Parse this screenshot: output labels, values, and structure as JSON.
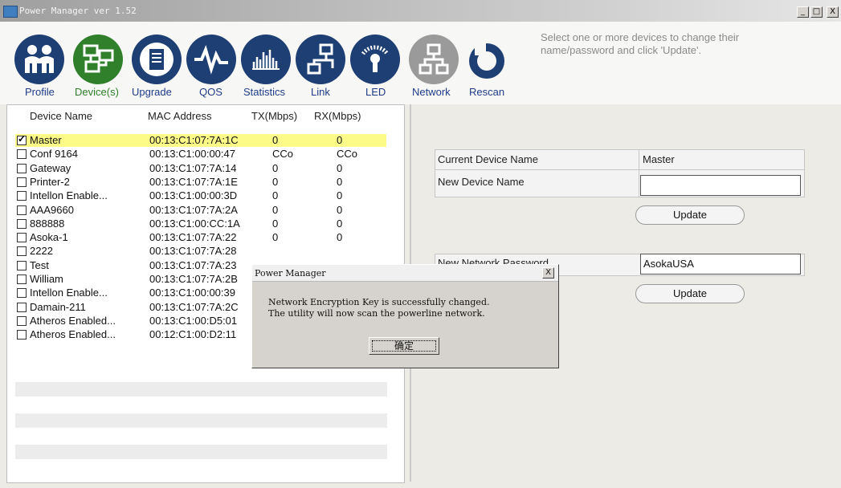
{
  "window": {
    "title": "Power Manager ver 1.52",
    "minimize": "_",
    "maximize": "□",
    "close": "X"
  },
  "toolbar": {
    "items": [
      {
        "label": "Profile",
        "icon": "people-icon",
        "color": "#1e3f73"
      },
      {
        "label": "Device(s)",
        "icon": "devices-icon",
        "color": "#2f7f2b"
      },
      {
        "label": "Upgrade",
        "icon": "upgrade-icon",
        "color": "#1e3f73"
      },
      {
        "label": "QOS",
        "icon": "waveform-icon",
        "color": "#1e3f73"
      },
      {
        "label": "Statistics",
        "icon": "bar-chart-icon",
        "color": "#1e3f73"
      },
      {
        "label": "Link",
        "icon": "network-link-icon",
        "color": "#1e3f73"
      },
      {
        "label": "LED",
        "icon": "led-icon",
        "color": "#1e3f73"
      },
      {
        "label": "Network",
        "icon": "network-tree-icon",
        "color": "#9a9a9a"
      },
      {
        "label": "Rescan",
        "icon": "rescan-icon",
        "color": "#1e3f73"
      }
    ],
    "hint": "Select one or more devices to change their name/password and click 'Update'."
  },
  "device_list": {
    "headers": {
      "name": "Device Name",
      "mac": "MAC Address",
      "tx": "TX(Mbps)",
      "rx": "RX(Mbps)"
    },
    "rows": [
      {
        "checked": true,
        "name": "Master",
        "mac": "00:13:C1:07:7A:1C",
        "tx": "0",
        "rx": "0"
      },
      {
        "checked": false,
        "name": "Conf 9164",
        "mac": "00:13:C1:00:00:47",
        "tx": "CCo",
        "rx": "CCo"
      },
      {
        "checked": false,
        "name": "Gateway",
        "mac": "00:13:C1:07:7A:14",
        "tx": "0",
        "rx": "0"
      },
      {
        "checked": false,
        "name": "Printer-2",
        "mac": "00:13:C1:07:7A:1E",
        "tx": "0",
        "rx": "0"
      },
      {
        "checked": false,
        "name": "Intellon Enable...",
        "mac": "00:13:C1:00:00:3D",
        "tx": "0",
        "rx": "0"
      },
      {
        "checked": false,
        "name": "AAA9660",
        "mac": "00:13:C1:07:7A:2A",
        "tx": "0",
        "rx": "0"
      },
      {
        "checked": false,
        "name": "888888",
        "mac": "00:13:C1:00:CC:1A",
        "tx": "0",
        "rx": "0"
      },
      {
        "checked": false,
        "name": "Asoka-1",
        "mac": "00:13:C1:07:7A:22",
        "tx": "0",
        "rx": "0"
      },
      {
        "checked": false,
        "name": "2222",
        "mac": "00:13:C1:07:7A:28",
        "tx": "",
        "rx": ""
      },
      {
        "checked": false,
        "name": "Test",
        "mac": "00:13:C1:07:7A:23",
        "tx": "",
        "rx": ""
      },
      {
        "checked": false,
        "name": "William",
        "mac": "00:13:C1:07:7A:2B",
        "tx": "",
        "rx": ""
      },
      {
        "checked": false,
        "name": "Intellon Enable...",
        "mac": "00:13:C1:00:00:39",
        "tx": "",
        "rx": ""
      },
      {
        "checked": false,
        "name": "Damain-211",
        "mac": "00:13:C1:07:7A:2C",
        "tx": "",
        "rx": ""
      },
      {
        "checked": false,
        "name": "Atheros Enabled...",
        "mac": "00:13:C1:00:D5:01",
        "tx": "",
        "rx": ""
      },
      {
        "checked": false,
        "name": "Atheros Enabled...",
        "mac": "00:12:C1:00:D2:11",
        "tx": "",
        "rx": ""
      }
    ]
  },
  "device_panel": {
    "current_name_label": "Current Device Name",
    "current_name_value": "Master",
    "new_name_label": "New Device Name",
    "new_name_value": "",
    "update_label": "Update",
    "password_label": "New Network Password",
    "password_value": "AsokaUSA",
    "update2_label": "Update"
  },
  "dialog": {
    "title": "Power Manager",
    "close": "X",
    "message_line1": "Network Encryption Key is successfully changed.",
    "message_line2": "The utility will now scan the powerline network.",
    "ok_label": "确定"
  }
}
